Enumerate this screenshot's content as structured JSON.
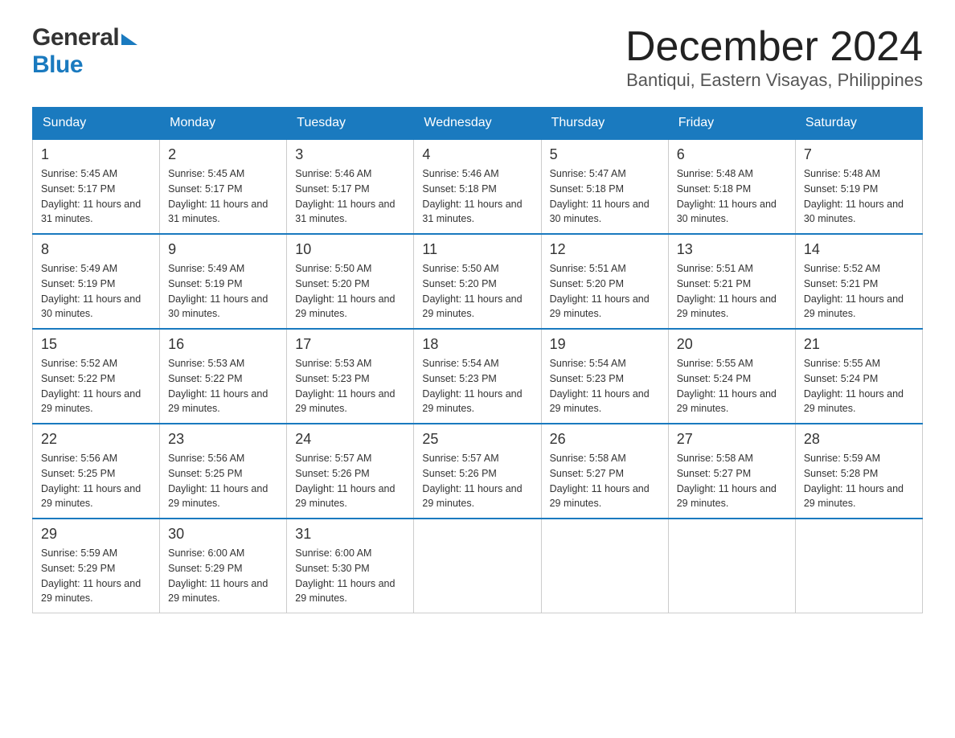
{
  "header": {
    "logo_general": "General",
    "logo_blue": "Blue",
    "title": "December 2024",
    "subtitle": "Bantiqui, Eastern Visayas, Philippines"
  },
  "days_of_week": [
    "Sunday",
    "Monday",
    "Tuesday",
    "Wednesday",
    "Thursday",
    "Friday",
    "Saturday"
  ],
  "weeks": [
    [
      {
        "day": "1",
        "sunrise": "5:45 AM",
        "sunset": "5:17 PM",
        "daylight": "11 hours and 31 minutes."
      },
      {
        "day": "2",
        "sunrise": "5:45 AM",
        "sunset": "5:17 PM",
        "daylight": "11 hours and 31 minutes."
      },
      {
        "day": "3",
        "sunrise": "5:46 AM",
        "sunset": "5:17 PM",
        "daylight": "11 hours and 31 minutes."
      },
      {
        "day": "4",
        "sunrise": "5:46 AM",
        "sunset": "5:18 PM",
        "daylight": "11 hours and 31 minutes."
      },
      {
        "day": "5",
        "sunrise": "5:47 AM",
        "sunset": "5:18 PM",
        "daylight": "11 hours and 30 minutes."
      },
      {
        "day": "6",
        "sunrise": "5:48 AM",
        "sunset": "5:18 PM",
        "daylight": "11 hours and 30 minutes."
      },
      {
        "day": "7",
        "sunrise": "5:48 AM",
        "sunset": "5:19 PM",
        "daylight": "11 hours and 30 minutes."
      }
    ],
    [
      {
        "day": "8",
        "sunrise": "5:49 AM",
        "sunset": "5:19 PM",
        "daylight": "11 hours and 30 minutes."
      },
      {
        "day": "9",
        "sunrise": "5:49 AM",
        "sunset": "5:19 PM",
        "daylight": "11 hours and 30 minutes."
      },
      {
        "day": "10",
        "sunrise": "5:50 AM",
        "sunset": "5:20 PM",
        "daylight": "11 hours and 29 minutes."
      },
      {
        "day": "11",
        "sunrise": "5:50 AM",
        "sunset": "5:20 PM",
        "daylight": "11 hours and 29 minutes."
      },
      {
        "day": "12",
        "sunrise": "5:51 AM",
        "sunset": "5:20 PM",
        "daylight": "11 hours and 29 minutes."
      },
      {
        "day": "13",
        "sunrise": "5:51 AM",
        "sunset": "5:21 PM",
        "daylight": "11 hours and 29 minutes."
      },
      {
        "day": "14",
        "sunrise": "5:52 AM",
        "sunset": "5:21 PM",
        "daylight": "11 hours and 29 minutes."
      }
    ],
    [
      {
        "day": "15",
        "sunrise": "5:52 AM",
        "sunset": "5:22 PM",
        "daylight": "11 hours and 29 minutes."
      },
      {
        "day": "16",
        "sunrise": "5:53 AM",
        "sunset": "5:22 PM",
        "daylight": "11 hours and 29 minutes."
      },
      {
        "day": "17",
        "sunrise": "5:53 AM",
        "sunset": "5:23 PM",
        "daylight": "11 hours and 29 minutes."
      },
      {
        "day": "18",
        "sunrise": "5:54 AM",
        "sunset": "5:23 PM",
        "daylight": "11 hours and 29 minutes."
      },
      {
        "day": "19",
        "sunrise": "5:54 AM",
        "sunset": "5:23 PM",
        "daylight": "11 hours and 29 minutes."
      },
      {
        "day": "20",
        "sunrise": "5:55 AM",
        "sunset": "5:24 PM",
        "daylight": "11 hours and 29 minutes."
      },
      {
        "day": "21",
        "sunrise": "5:55 AM",
        "sunset": "5:24 PM",
        "daylight": "11 hours and 29 minutes."
      }
    ],
    [
      {
        "day": "22",
        "sunrise": "5:56 AM",
        "sunset": "5:25 PM",
        "daylight": "11 hours and 29 minutes."
      },
      {
        "day": "23",
        "sunrise": "5:56 AM",
        "sunset": "5:25 PM",
        "daylight": "11 hours and 29 minutes."
      },
      {
        "day": "24",
        "sunrise": "5:57 AM",
        "sunset": "5:26 PM",
        "daylight": "11 hours and 29 minutes."
      },
      {
        "day": "25",
        "sunrise": "5:57 AM",
        "sunset": "5:26 PM",
        "daylight": "11 hours and 29 minutes."
      },
      {
        "day": "26",
        "sunrise": "5:58 AM",
        "sunset": "5:27 PM",
        "daylight": "11 hours and 29 minutes."
      },
      {
        "day": "27",
        "sunrise": "5:58 AM",
        "sunset": "5:27 PM",
        "daylight": "11 hours and 29 minutes."
      },
      {
        "day": "28",
        "sunrise": "5:59 AM",
        "sunset": "5:28 PM",
        "daylight": "11 hours and 29 minutes."
      }
    ],
    [
      {
        "day": "29",
        "sunrise": "5:59 AM",
        "sunset": "5:29 PM",
        "daylight": "11 hours and 29 minutes."
      },
      {
        "day": "30",
        "sunrise": "6:00 AM",
        "sunset": "5:29 PM",
        "daylight": "11 hours and 29 minutes."
      },
      {
        "day": "31",
        "sunrise": "6:00 AM",
        "sunset": "5:30 PM",
        "daylight": "11 hours and 29 minutes."
      },
      null,
      null,
      null,
      null
    ]
  ],
  "labels": {
    "sunrise": "Sunrise:",
    "sunset": "Sunset:",
    "daylight": "Daylight:"
  },
  "accent_color": "#1a7abf"
}
